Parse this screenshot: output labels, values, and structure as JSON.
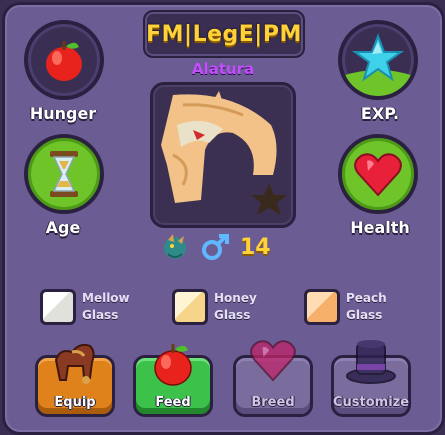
{
  "title": "FM|LegE|PM",
  "pet_name": "Alatura",
  "stats": {
    "hunger": {
      "label": "Hunger",
      "icon": "apple-icon"
    },
    "exp": {
      "label": "EXP.",
      "icon": "star-icon"
    },
    "age": {
      "label": "Age",
      "icon": "hourglass-icon"
    },
    "health": {
      "label": "Health",
      "icon": "heart-icon"
    }
  },
  "pet_info": {
    "type_icon": "dragon-icon",
    "gender_icon": "male-icon",
    "age_value": "14"
  },
  "potions": [
    {
      "line1": "Mellow",
      "line2": "Glass",
      "color": "#eeeeea"
    },
    {
      "line1": "Honey",
      "line2": "Glass",
      "color": "#f8e2a8"
    },
    {
      "line1": "Peach",
      "line2": "Glass",
      "color": "#f7c089"
    }
  ],
  "actions": {
    "equip": {
      "label": "Equip",
      "icon": "saddle-icon"
    },
    "feed": {
      "label": "Feed",
      "icon": "apple-icon"
    },
    "breed": {
      "label": "Breed",
      "icon": "heart-icon"
    },
    "customize": {
      "label": "Customize",
      "icon": "top-hat-icon"
    }
  },
  "colors": {
    "panel": "#6b5c93",
    "title": "#ffd23a",
    "pet_name": "#c44dff",
    "equip": "#e0821b",
    "feed": "#3cc24a",
    "disabled": "#7a6d9e"
  }
}
